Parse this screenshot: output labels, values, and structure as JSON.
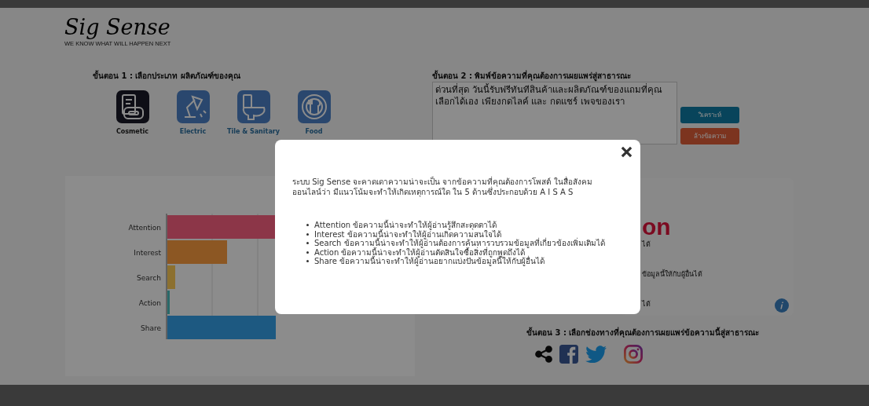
{
  "logo": {
    "name": "Sig Sense",
    "tagline": "WE KNOW WHAT WILL HAPPEN NEXT"
  },
  "step1": {
    "heading": "ขั้นตอน 1 : เลือกประเภท ผลิตภัณฑ์ของคุณ",
    "categories": [
      {
        "label": "Cosmetic",
        "kind": "cosmetic",
        "selected": true
      },
      {
        "label": "Electric",
        "kind": "electric",
        "selected": false
      },
      {
        "label": "Tile & Sanitary",
        "kind": "tile",
        "selected": false
      },
      {
        "label": "Food",
        "kind": "food",
        "selected": false
      }
    ]
  },
  "step2": {
    "heading": "ขั้นตอน 2 : พิมพ์ข้อความที่คุณต้องการเผยแพร่สู่สาธารณะ",
    "message": "ด่วนที่สุด วันนี้รับฟรีทันทีสินค้าและผลิตภัณฑ์ของแถมที่คุณ เลือกได้เอง เพียงกดไลค์ และ กดแชร์ เพจของเรา",
    "buttons": [
      {
        "label": "วิเคราะห์",
        "kind": "analyze"
      },
      {
        "label": "ล้างข้อความ",
        "kind": "clear"
      }
    ]
  },
  "chart": {
    "bars": [
      {
        "label": "Attention"
      },
      {
        "label": "Interest"
      },
      {
        "label": "Search"
      },
      {
        "label": "Action"
      },
      {
        "label": "Share"
      }
    ]
  },
  "result": {
    "title": "on",
    "lines": [
      "ได้",
      "ข้อมูลนี้ให้กับผู้อื่นได้",
      "ได้"
    ]
  },
  "step3": {
    "heading": "ขั้นตอน 3 : เลือกช่องทางที่คุณต้องการเผยแพร่ข้อความนี้สู่สาธารณะ",
    "channels": [
      {
        "kind": "share"
      },
      {
        "kind": "facebook"
      },
      {
        "kind": "twitter"
      },
      {
        "kind": "instagram"
      }
    ]
  },
  "modal": {
    "intro": "ระบบ Sig Sense จะคาดเดาความน่าจะเป็น จากข้อความที่คุณต้องการโพสต์ ในสื่อสังคมออนไลน์ว่า มีแนวโน้มจะทำให้เกิดเหตุการณ์ใด ใน 5 ด้านซึ่งประกอบด้วย A I S A S",
    "items": [
      "Attention ข้อความนี้น่าจะทำให้ผู้อ่านรู้สึกสะดุดตาได้",
      "Interest ข้อความนี้น่าจะทำให้ผู้อ่านเกิดความสนใจได้",
      "Search ข้อความนี้น่าจะทำให้ผู้อ่านต้องการค้นหารวบรวมข้อมูลที่เกี่ยวข้องเพิ่มเติมได้",
      "Action ข้อความนี้น่าจะทำให้ผู้อ่านตัดสินใจซื้อสิ่งที่ถูกพูดถึงได้",
      "Share ข้อความนี้น่าจะทำให้ผู้อ่านอยากแบ่งปันข้อมูลนี้ให้กับผู้อื่นได้"
    ]
  }
}
